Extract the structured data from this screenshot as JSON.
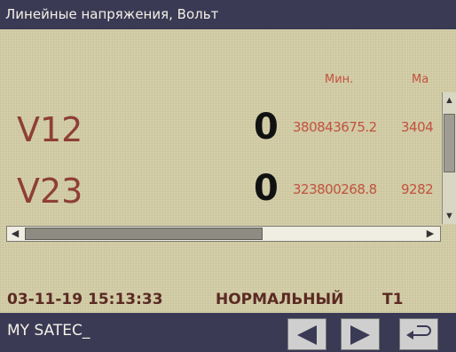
{
  "window": {
    "title": "Линейные напряжения, Вольт"
  },
  "table": {
    "columns": {
      "min": "Мин.",
      "max": "Ма"
    },
    "rows": [
      {
        "label": "V12",
        "value": "0",
        "min": "380843675.2",
        "max": "3404"
      },
      {
        "label": "V23",
        "value": "0",
        "min": "323800268.8",
        "max": "9282"
      }
    ]
  },
  "status_bar": {
    "datetime": "03-11-19 15:13:33",
    "state": "НОРМАЛЬНЫЙ",
    "tariff": "T1"
  },
  "bottom_bar": {
    "device_name": "MY SATEC_",
    "buttons": [
      "arrow-left-icon",
      "arrow-right-icon",
      "return-icon"
    ]
  },
  "colors": {
    "screen_bg": "#d4cfa9",
    "bar_bg": "#3b3a55",
    "label_red": "#8e3f36",
    "data_red": "#c2523f"
  }
}
